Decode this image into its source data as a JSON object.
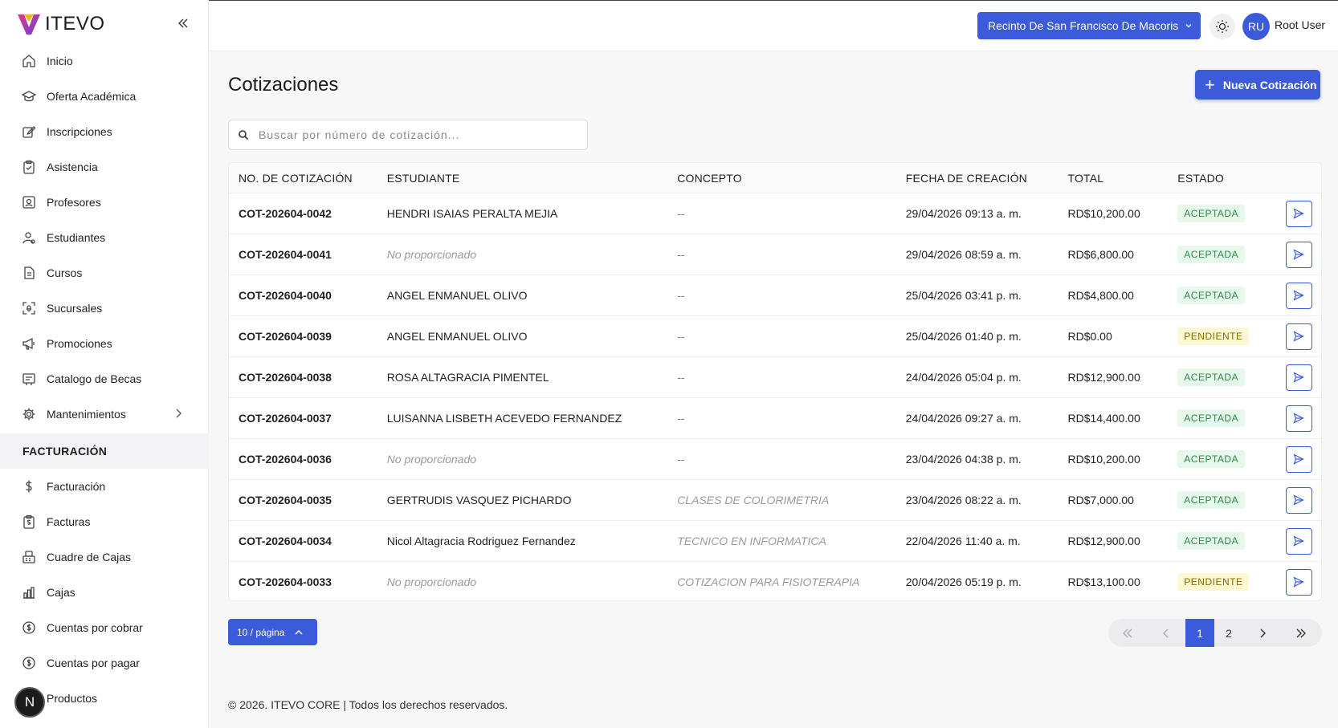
{
  "brand": {
    "name": "ITEVO"
  },
  "sidebar": {
    "items": [
      {
        "label": "Inicio",
        "icon": "home-icon"
      },
      {
        "label": "Oferta Académica",
        "icon": "graduation-cap-icon"
      },
      {
        "label": "Inscripciones",
        "icon": "edit-icon"
      },
      {
        "label": "Asistencia",
        "icon": "clipboard-check-icon"
      },
      {
        "label": "Profesores",
        "icon": "teacher-icon"
      },
      {
        "label": "Estudiantes",
        "icon": "users-icon"
      },
      {
        "label": "Cursos",
        "icon": "document-icon"
      },
      {
        "label": "Sucursales",
        "icon": "location-icon"
      },
      {
        "label": "Promociones",
        "icon": "megaphone-icon"
      },
      {
        "label": "Catalogo de Becas",
        "icon": "catalog-icon"
      },
      {
        "label": "Mantenimientos",
        "icon": "gear-icon"
      }
    ],
    "section": "FACTURACIÓN",
    "billing_items": [
      {
        "label": "Facturación",
        "icon": "dollar-icon"
      },
      {
        "label": "Facturas",
        "icon": "receipt-icon"
      },
      {
        "label": "Cuadre de Cajas",
        "icon": "cash-register-icon"
      },
      {
        "label": "Cajas",
        "icon": "chart-box-icon"
      },
      {
        "label": "Cuentas por cobrar",
        "icon": "coin-icon"
      },
      {
        "label": "Cuentas por pagar",
        "icon": "coin-icon"
      },
      {
        "label": "Productos",
        "icon": "box-icon"
      }
    ],
    "fab_label": "N"
  },
  "header": {
    "branch": "Recinto De San Francisco De Macoris",
    "avatar_initials": "RU",
    "user_name": "Root User"
  },
  "main": {
    "title": "Cotizaciones",
    "new_button": "Nueva Cotización",
    "search_placeholder": "Buscar por número de cotización..."
  },
  "table": {
    "columns": [
      "NO. DE COTIZACIÓN",
      "ESTUDIANTE",
      "CONCEPTO",
      "FECHA DE CREACIÓN",
      "TOTAL",
      "ESTADO"
    ],
    "rows": [
      {
        "no": "COT-202604-0042",
        "student": "HENDRI ISAIAS PERALTA MEJIA",
        "student_muted": false,
        "concept": "--",
        "concept_muted": false,
        "date": "29/04/2026 09:13 a. m.",
        "total": "RD$10,200.00",
        "status": "ACEPTADA"
      },
      {
        "no": "COT-202604-0041",
        "student": "No proporcionado",
        "student_muted": true,
        "concept": "--",
        "concept_muted": false,
        "date": "29/04/2026 08:59 a. m.",
        "total": "RD$6,800.00",
        "status": "ACEPTADA"
      },
      {
        "no": "COT-202604-0040",
        "student": "ANGEL ENMANUEL OLIVO",
        "student_muted": false,
        "concept": "--",
        "concept_muted": false,
        "date": "25/04/2026 03:41 p. m.",
        "total": "RD$4,800.00",
        "status": "ACEPTADA"
      },
      {
        "no": "COT-202604-0039",
        "student": "ANGEL ENMANUEL OLIVO",
        "student_muted": false,
        "concept": "--",
        "concept_muted": false,
        "date": "25/04/2026 01:40 p. m.",
        "total": "RD$0.00",
        "status": "PENDIENTE"
      },
      {
        "no": "COT-202604-0038",
        "student": "ROSA ALTAGRACIA PIMENTEL",
        "student_muted": false,
        "concept": "--",
        "concept_muted": false,
        "date": "24/04/2026 05:04 p. m.",
        "total": "RD$12,900.00",
        "status": "ACEPTADA"
      },
      {
        "no": "COT-202604-0037",
        "student": "LUISANNA LISBETH ACEVEDO FERNANDEZ",
        "student_muted": false,
        "concept": "--",
        "concept_muted": false,
        "date": "24/04/2026 09:27 a. m.",
        "total": "RD$14,400.00",
        "status": "ACEPTADA"
      },
      {
        "no": "COT-202604-0036",
        "student": "No proporcionado",
        "student_muted": true,
        "concept": "--",
        "concept_muted": false,
        "date": "23/04/2026 04:38 p. m.",
        "total": "RD$10,200.00",
        "status": "ACEPTADA"
      },
      {
        "no": "COT-202604-0035",
        "student": "GERTRUDIS VASQUEZ PICHARDO",
        "student_muted": false,
        "concept": "CLASES DE COLORIMETRIA",
        "concept_muted": true,
        "date": "23/04/2026 08:22 a. m.",
        "total": "RD$7,000.00",
        "status": "ACEPTADA"
      },
      {
        "no": "COT-202604-0034",
        "student": "Nicol Altagracia Rodriguez Fernandez",
        "student_muted": false,
        "concept": "TECNICO EN INFORMATICA",
        "concept_muted": true,
        "date": "22/04/2026 11:40 a. m.",
        "total": "RD$12,900.00",
        "status": "ACEPTADA"
      },
      {
        "no": "COT-202604-0033",
        "student": "No proporcionado",
        "student_muted": true,
        "concept": "COTIZACION PARA FISIOTERAPIA",
        "concept_muted": true,
        "date": "20/04/2026 05:19 p. m.",
        "total": "RD$13,100.00",
        "status": "PENDIENTE"
      }
    ]
  },
  "pagination": {
    "page_size_label": "10 / página",
    "pages": [
      "1",
      "2"
    ],
    "current_page": "1"
  },
  "footer": {
    "text": "© 2026. ITEVO CORE | Todos los derechos reservados."
  },
  "colors": {
    "accent": "#3b5bdb",
    "accepted": "#2f8a47",
    "pending": "#8a6a00"
  }
}
